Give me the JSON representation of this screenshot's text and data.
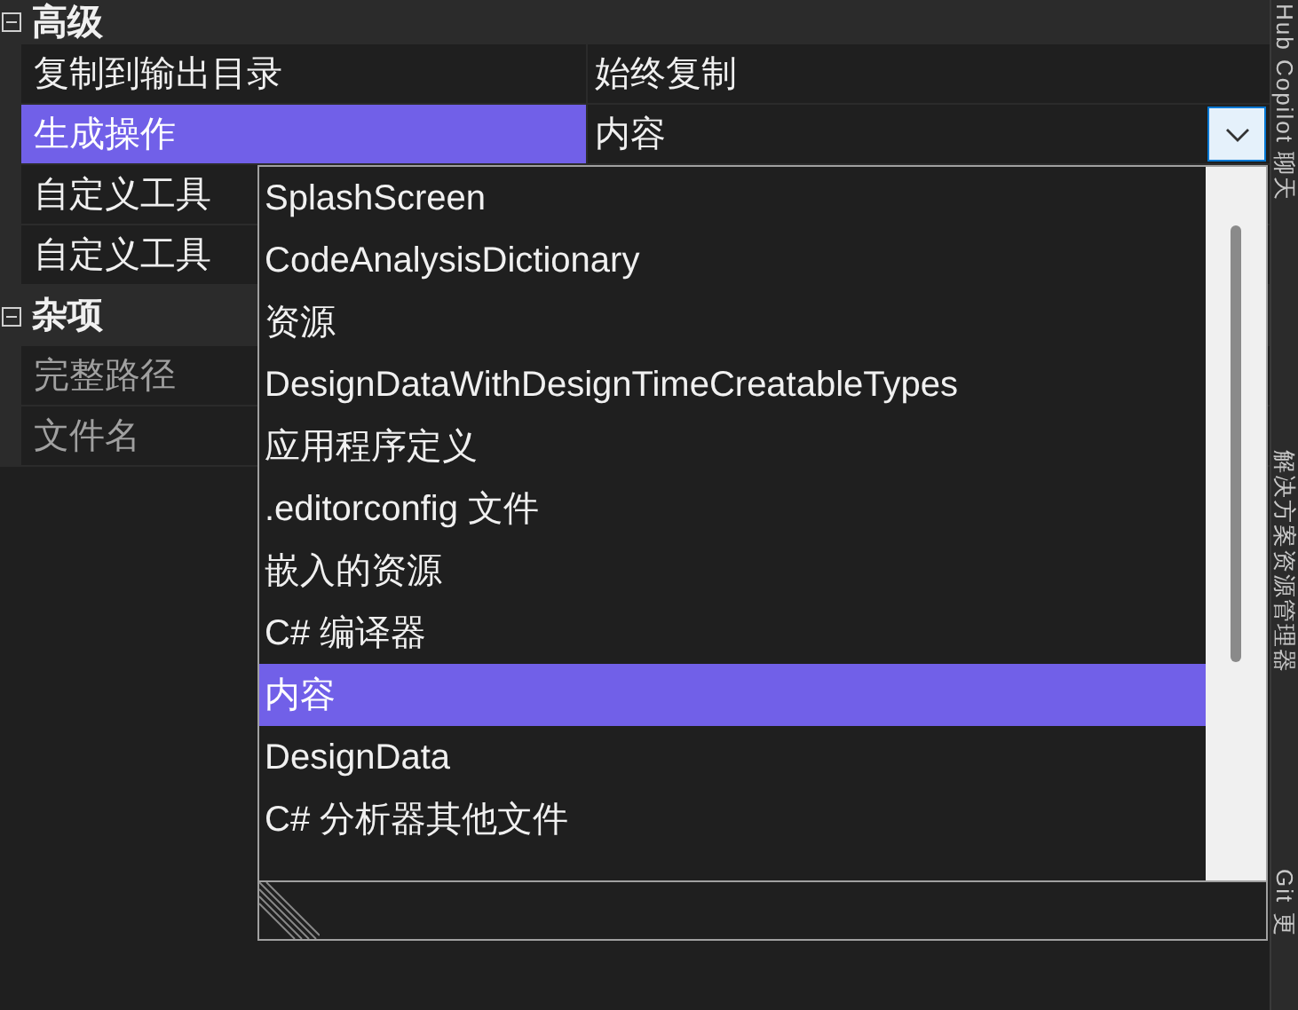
{
  "categories": [
    {
      "title": "高级",
      "expanded": true,
      "properties": [
        {
          "name": "复制到输出目录",
          "value": "始终复制",
          "selected": false,
          "disabled": false
        },
        {
          "name": "生成操作",
          "value": "内容",
          "selected": true,
          "disabled": false
        },
        {
          "name": "自定义工具",
          "selected": false,
          "disabled": false
        },
        {
          "name": "自定义工具",
          "selected": false,
          "disabled": false
        }
      ]
    },
    {
      "title": "杂项",
      "expanded": true,
      "properties": [
        {
          "name": "完整路径",
          "selected": false,
          "disabled": true
        },
        {
          "name": "文件名",
          "selected": false,
          "disabled": true
        }
      ]
    }
  ],
  "dropdown": {
    "items": [
      {
        "label": "SplashScreen",
        "selected": false
      },
      {
        "label": "CodeAnalysisDictionary",
        "selected": false
      },
      {
        "label": "资源",
        "selected": false
      },
      {
        "label": "DesignDataWithDesignTimeCreatableTypes",
        "selected": false
      },
      {
        "label": "应用程序定义",
        "selected": false
      },
      {
        "label": ".editorconfig 文件",
        "selected": false
      },
      {
        "label": "嵌入的资源",
        "selected": false
      },
      {
        "label": "C# 编译器",
        "selected": false
      },
      {
        "label": "内容",
        "selected": true
      },
      {
        "label": "DesignData",
        "selected": false
      },
      {
        "label": "C# 分析器其他文件",
        "selected": false
      }
    ]
  },
  "side_tabs": [
    "Hub Copilot 聊天",
    "解决方案资源管理器",
    "Git 更"
  ]
}
